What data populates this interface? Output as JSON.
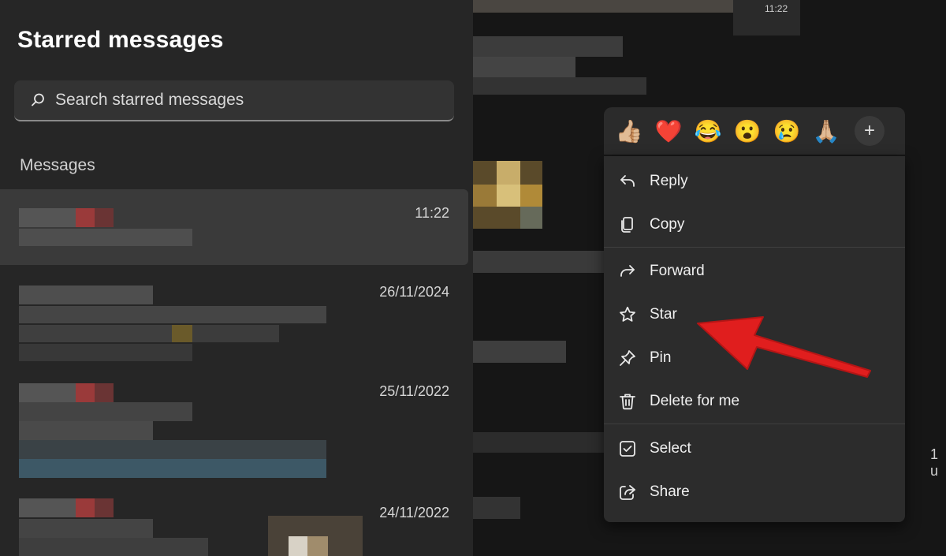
{
  "panel": {
    "title": "Starred messages",
    "search_placeholder": "Search starred messages",
    "section_label": "Messages"
  },
  "messages": [
    {
      "time": "11:22"
    },
    {
      "time": "26/11/2024"
    },
    {
      "time": "25/11/2022"
    },
    {
      "time": "24/11/2022"
    }
  ],
  "chat": {
    "visible_time": "11:22",
    "partial_time": "1 u"
  },
  "reactions": {
    "emojis": [
      "👍🏼",
      "❤️",
      "😂",
      "😮",
      "😢",
      "🙏🏼"
    ],
    "more_label": "+"
  },
  "context_menu": {
    "items": [
      {
        "label": "Reply",
        "icon": "reply-icon"
      },
      {
        "label": "Copy",
        "icon": "copy-icon"
      },
      {
        "label": "Forward",
        "icon": "forward-icon"
      },
      {
        "label": "Star",
        "icon": "star-icon"
      },
      {
        "label": "Pin",
        "icon": "pin-icon"
      },
      {
        "label": "Delete for me",
        "icon": "trash-icon"
      },
      {
        "label": "Select",
        "icon": "checkbox-icon"
      },
      {
        "label": "Share",
        "icon": "share-icon"
      }
    ]
  },
  "colors": {
    "annotation_arrow": "#e01e1e",
    "panel_bg": "#262626",
    "menu_bg": "#2c2c2c"
  }
}
